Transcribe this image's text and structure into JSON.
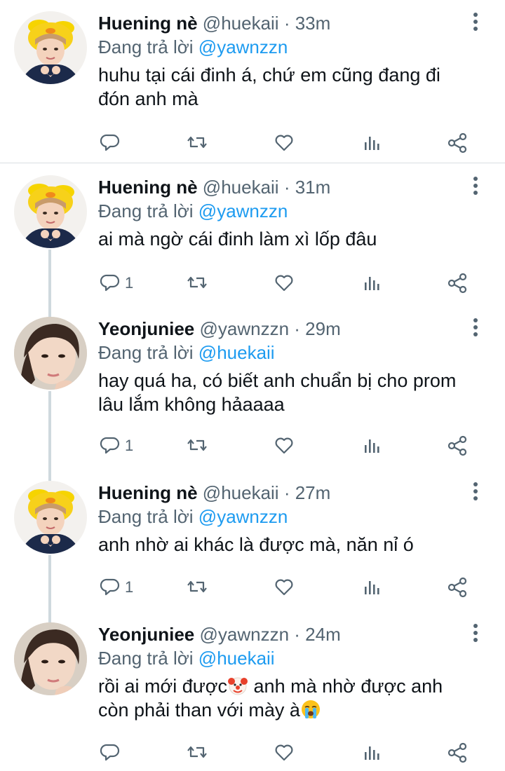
{
  "reply_prefix": "Đang trả lời",
  "tweets": [
    {
      "author": "Huening nè",
      "handle": "@huekaii",
      "time": "33m",
      "reply_to": "@yawnzzn",
      "text": "huhu tại cái đinh á, chứ em cũng đang đi đón anh mà",
      "reply_count": ""
    },
    {
      "author": "Huening nè",
      "handle": "@huekaii",
      "time": "31m",
      "reply_to": "@yawnzzn",
      "text": "ai mà ngờ cái đinh làm xì lốp đâu",
      "reply_count": "1"
    },
    {
      "author": "Yeonjuniee",
      "handle": "@yawnzzn",
      "time": "29m",
      "reply_to": "@huekaii",
      "text": "hay quá ha, có biết anh chuẩn bị cho prom lâu lắm không hảaaaa",
      "reply_count": "1"
    },
    {
      "author": "Huening nè",
      "handle": "@huekaii",
      "time": "27m",
      "reply_to": "@yawnzzn",
      "text": "anh nhờ ai khác là được mà, năn nỉ ó",
      "reply_count": "1"
    },
    {
      "author": "Yeonjuniee",
      "handle": "@yawnzzn",
      "time": "24m",
      "reply_to": "@huekaii",
      "text_part1": "rồi ai mới được",
      "emoji1": "clown-face-emoji",
      "text_part2": " anh mà nhờ được anh còn phải than với mày à",
      "emoji2": "loudly-crying-face-emoji",
      "reply_count": ""
    }
  ],
  "colors": {
    "text": "#0f1419",
    "secondary": "#536471",
    "mention": "#1d9bf0",
    "thread_line": "#cfd9de"
  }
}
